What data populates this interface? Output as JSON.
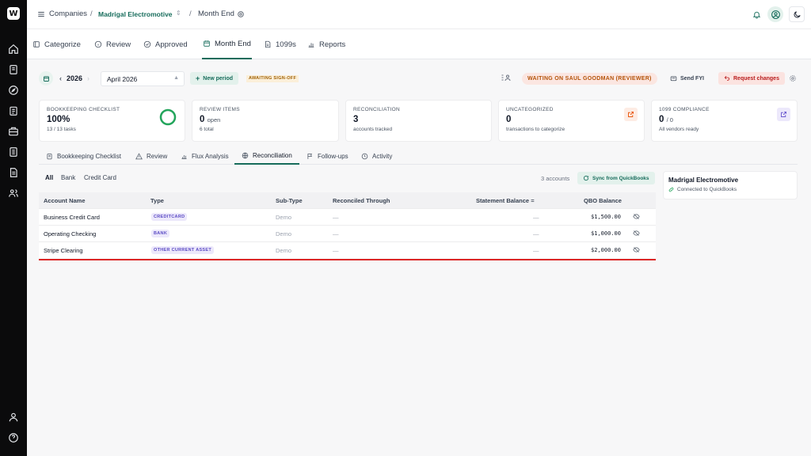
{
  "sidebar": {
    "logo_text": "W",
    "items": [
      {
        "name": "home-icon"
      },
      {
        "name": "inbox-icon"
      },
      {
        "name": "compass-icon"
      },
      {
        "name": "clipboard-icon"
      },
      {
        "name": "briefcase-icon"
      },
      {
        "name": "document-icon"
      },
      {
        "name": "file-text-icon"
      },
      {
        "name": "users-icon"
      }
    ],
    "bottom_items": [
      {
        "name": "user-icon"
      },
      {
        "name": "help-icon"
      }
    ]
  },
  "topbar": {
    "breadcrumb_root": "Companies",
    "separator": "/",
    "company": "Madrigal Electromotive",
    "page": "Month End"
  },
  "tabs": [
    {
      "label": "Categorize",
      "icon": "categorize-icon"
    },
    {
      "label": "Review",
      "icon": "info-circle-icon"
    },
    {
      "label": "Approved",
      "icon": "check-circle-icon"
    },
    {
      "label": "Month End",
      "icon": "calendar-icon",
      "active": true
    },
    {
      "label": "1099s",
      "icon": "file-icon"
    },
    {
      "label": "Reports",
      "icon": "bar-chart-icon"
    }
  ],
  "period": {
    "year": "2026",
    "month": "April 2026",
    "new_period_label": "New period",
    "status_badge": "AWAITING SIGN-OFF",
    "waiting_label": "WAITING ON SAUL GOODMAN (REVIEWER)",
    "send_fyi_label": "Send FYI",
    "request_changes_label": "Request changes"
  },
  "cards": [
    {
      "label": "BOOKKEEPING CHECKLIST",
      "value": "100%",
      "sub": "13 / 13 tasks",
      "progress": 1.0
    },
    {
      "label": "REVIEW ITEMS",
      "value": "0",
      "value_suffix": "open",
      "sub": "6 total"
    },
    {
      "label": "RECONCILIATION",
      "value": "3",
      "sub": "accounts tracked"
    },
    {
      "label": "UNCATEGORIZED",
      "value": "0",
      "sub": "transactions to categorize"
    },
    {
      "label": "1099 COMPLIANCE",
      "value": "0",
      "value_suffix": "/ 0",
      "sub": "All vendors ready"
    }
  ],
  "subtabs": [
    {
      "label": "Bookkeeping Checklist",
      "icon": "checklist-icon"
    },
    {
      "label": "Review",
      "icon": "warning-icon"
    },
    {
      "label": "Flux Analysis",
      "icon": "bar-chart-icon"
    },
    {
      "label": "Reconciliation",
      "icon": "globe-icon",
      "active": true
    },
    {
      "label": "Follow-ups",
      "icon": "flag-icon"
    },
    {
      "label": "Activity",
      "icon": "history-icon"
    }
  ],
  "filters": {
    "items": [
      "All",
      "Bank",
      "Credit Card"
    ],
    "active": "All",
    "count_text": "3 accounts",
    "sync_label": "Sync from QuickBooks"
  },
  "table": {
    "headers": {
      "account_name": "Account Name",
      "type": "Type",
      "sub_type": "Sub-Type",
      "reconciled": "Reconciled Through",
      "statement": "Statement Balance",
      "statement_marker": "=",
      "qbo": "QBO Balance"
    },
    "rows": [
      {
        "name": "Business Credit Card",
        "type": "CREDITCARD",
        "sub_type": "Demo",
        "reconciled": "—",
        "statement": "—",
        "qbo": "$1,500.00"
      },
      {
        "name": "Operating Checking",
        "type": "BANK",
        "sub_type": "Demo",
        "reconciled": "—",
        "statement": "—",
        "qbo": "$1,000.00"
      },
      {
        "name": "Stripe Clearing",
        "type": "OTHER CURRENT ASSET",
        "sub_type": "Demo",
        "reconciled": "—",
        "statement": "—",
        "qbo": "$2,000.00"
      }
    ]
  },
  "company_panel": {
    "name": "Madrigal Electromotive",
    "status": "Connected to QuickBooks"
  },
  "colors": {
    "accent": "#166c5b",
    "progress_ring": "#22a55b",
    "warning": "#b45309",
    "danger": "#b91c1c",
    "badge_purple": "#5b4bc4"
  }
}
